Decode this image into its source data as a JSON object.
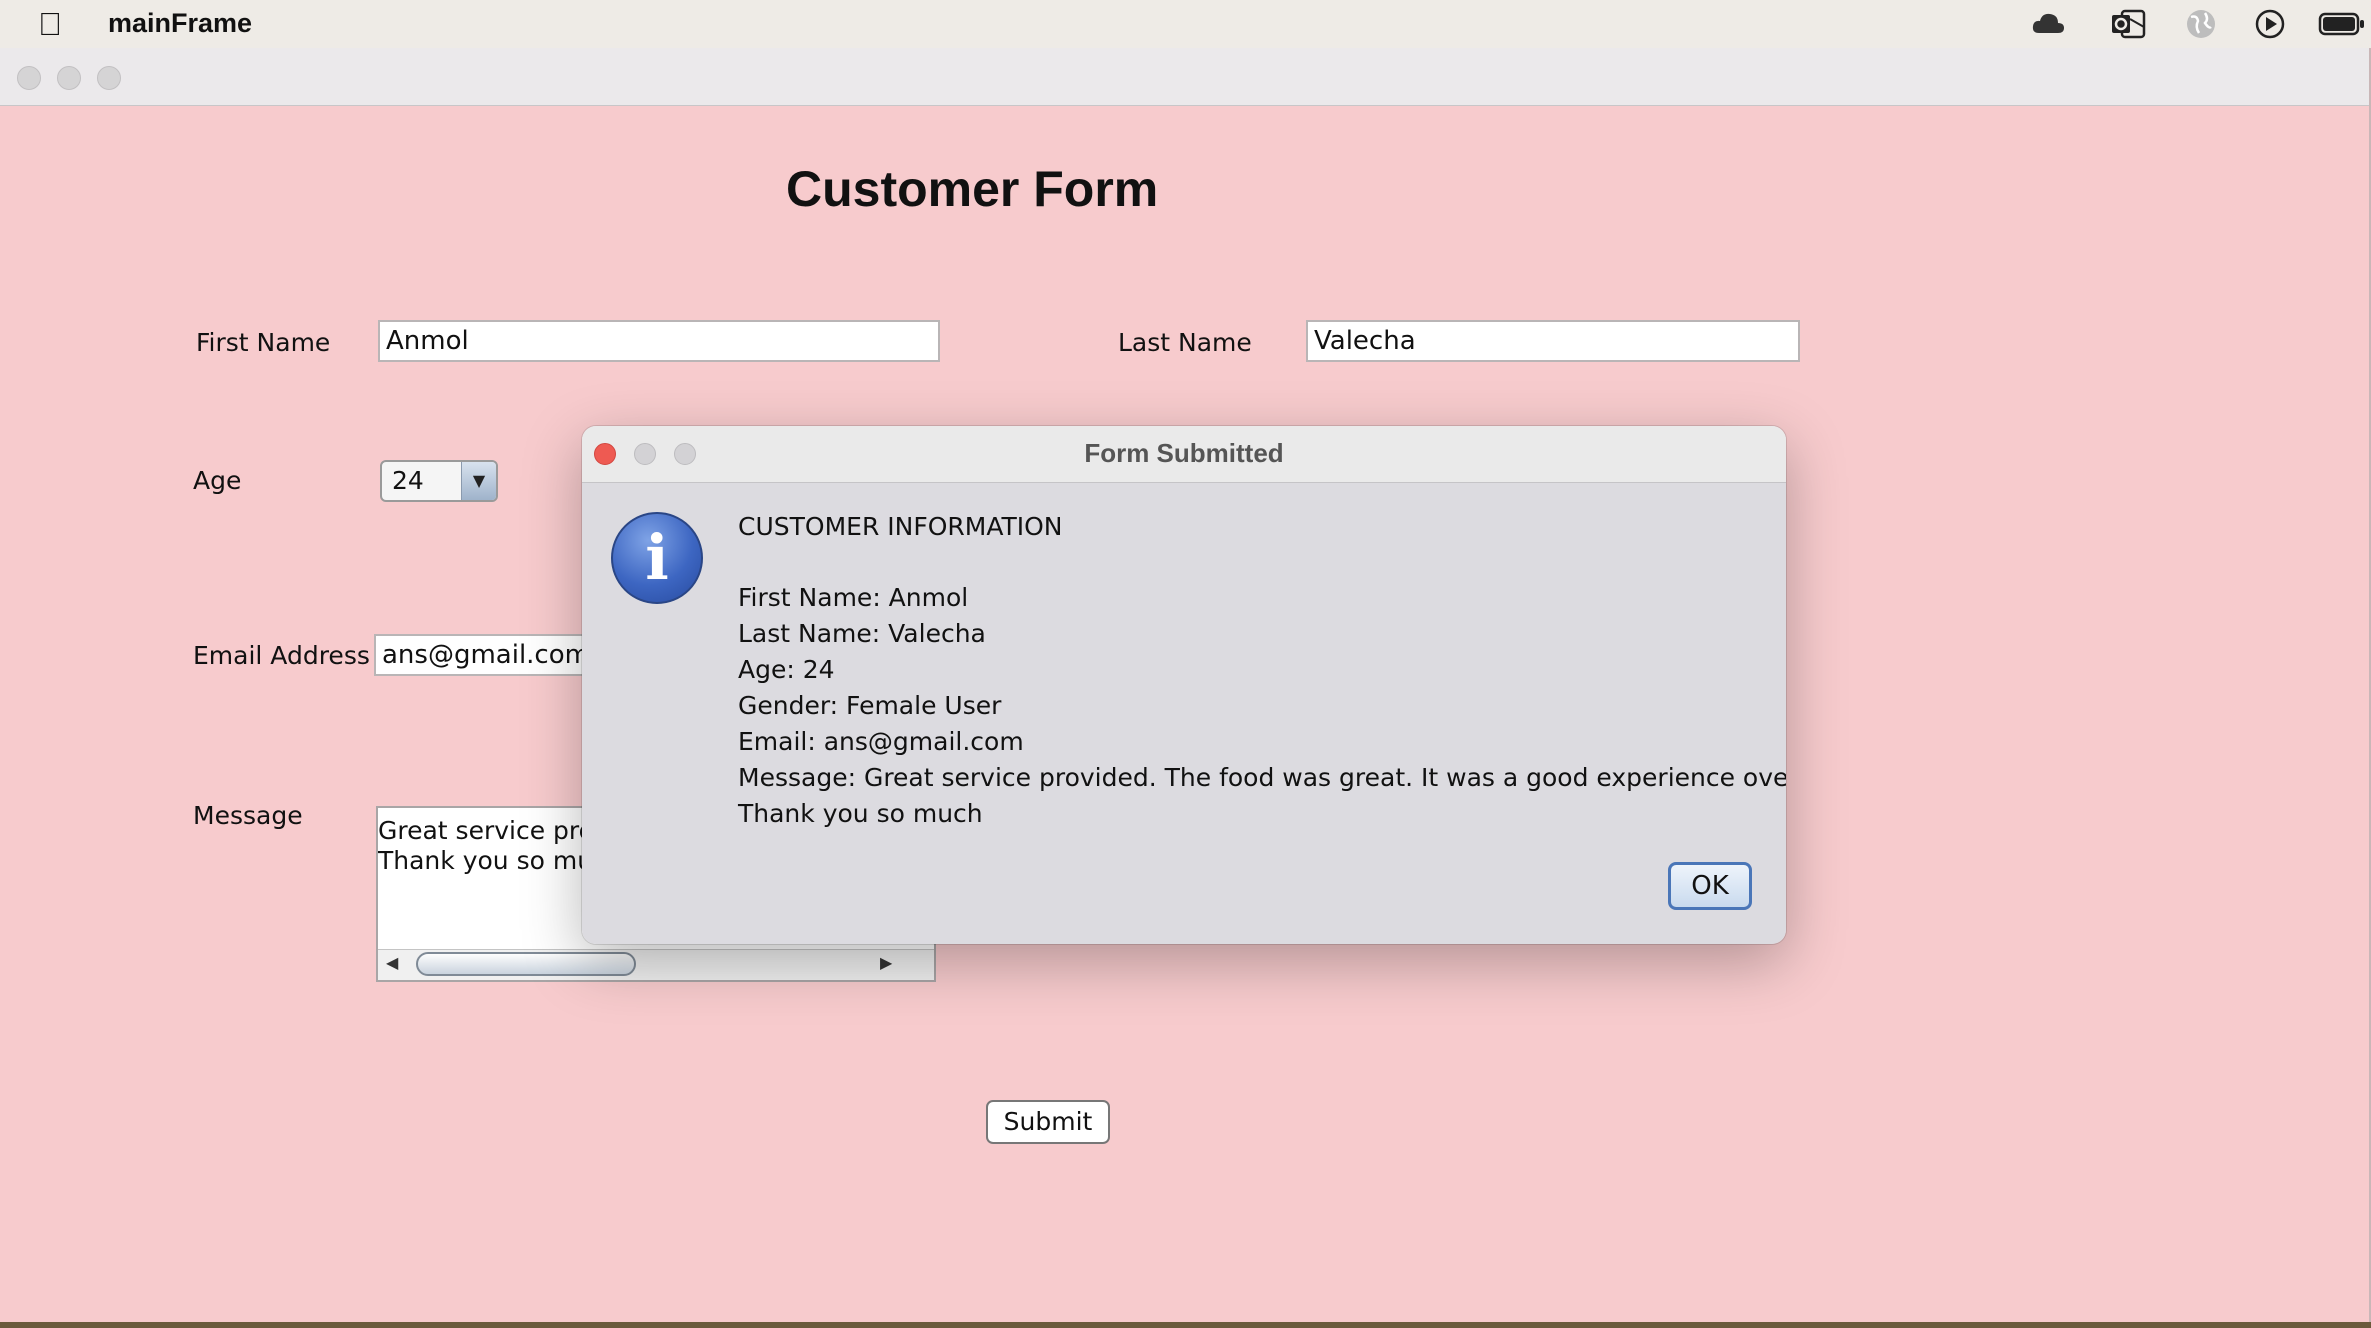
{
  "menubar": {
    "app_name": "mainFrame",
    "icons": [
      "apple-icon",
      "cloud-icon",
      "outlook-icon",
      "globe-icon",
      "play-icon",
      "battery-icon"
    ]
  },
  "form": {
    "title": "Customer Form",
    "first_name_label": "First Name",
    "first_name_value": "Anmol",
    "last_name_label": "Last Name",
    "last_name_value": "Valecha",
    "age_label": "Age",
    "age_value": "24",
    "email_label": "Email Address",
    "email_value": "ans@gmail.com",
    "message_label": "Message",
    "message_lines": [
      "Great service provided. The food was great. It was a good experience overall.",
      "Thank you so much"
    ],
    "submit_label": "Submit"
  },
  "dialog": {
    "title": "Form Submitted",
    "heading": "CUSTOMER INFORMATION",
    "lines": [
      "First Name: Anmol",
      "Last Name: Valecha",
      "Age: 24",
      "Gender: Female User",
      "Email: ans@gmail.com",
      "Message: Great service provided. The food was great. It was a good experience overall.",
      "Thank you so much"
    ],
    "ok_label": "OK"
  },
  "colors": {
    "window_bg": "#f7cbcd",
    "dialog_bg": "#dcdbe0",
    "close_red": "#ee5a52",
    "info_blue": "#3d66c2"
  }
}
